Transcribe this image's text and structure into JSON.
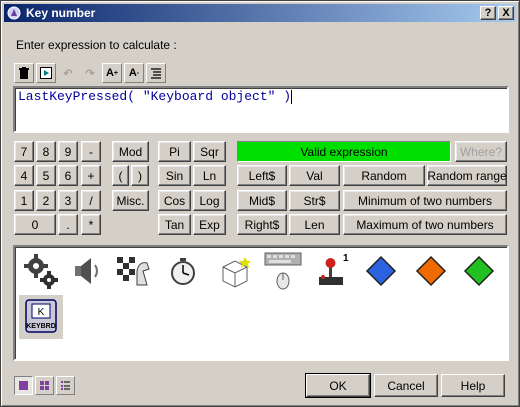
{
  "window": {
    "title": "Key number"
  },
  "titlebar_buttons": {
    "help": "?",
    "close": "X"
  },
  "prompt_label": "Enter expression to calculate :",
  "toolbar": {
    "items": [
      {
        "icon": "trash-icon",
        "glyph": "🗑"
      },
      {
        "icon": "insert-icon",
        "glyph": "▣"
      },
      {
        "icon": "undo-icon",
        "glyph": "↶"
      },
      {
        "icon": "redo-icon",
        "glyph": "↷"
      },
      {
        "icon": "font-larger-icon",
        "glyph": "A⁺"
      },
      {
        "icon": "font-smaller-icon",
        "glyph": "A⁻"
      },
      {
        "icon": "format-icon",
        "glyph": "⇶"
      }
    ]
  },
  "expression": "LastKeyPressed( \"Keyboard object\" )",
  "keypad": {
    "row1": [
      "7",
      "8",
      "9",
      "-"
    ],
    "row2": [
      "4",
      "5",
      "6",
      "+"
    ],
    "row3": [
      "1",
      "2",
      "3",
      "/"
    ],
    "row4": [
      "0",
      ".",
      "*"
    ]
  },
  "mod_label": "Mod",
  "paren_open": "(",
  "paren_close": ")",
  "misc_label": "Misc.",
  "functions": {
    "pi": "Pi",
    "sqr": "Sqr",
    "sin": "Sin",
    "ln": "Ln",
    "cos": "Cos",
    "log": "Log",
    "tan": "Tan",
    "exp": "Exp",
    "left": "Left$",
    "val": "Val",
    "mid": "Mid$",
    "str": "Str$",
    "right": "Right$",
    "len": "Len"
  },
  "status": "Valid expression",
  "where_label": "Where?",
  "random_label": "Random",
  "random_range_label": "Random range",
  "min_label": "Minimum of two numbers",
  "max_label": "Maximum of two numbers",
  "objects": [
    {
      "name": "special-conditions-icon"
    },
    {
      "name": "sound-icon"
    },
    {
      "name": "storyboard-icon"
    },
    {
      "name": "timer-icon"
    },
    {
      "name": "create-object-icon"
    },
    {
      "name": "mouse-keyboard-icon"
    },
    {
      "name": "player-joystick-icon",
      "badge": "1"
    },
    {
      "name": "blue-diamond-icon",
      "color": "#2a62e0"
    },
    {
      "name": "orange-diamond-icon",
      "color": "#f06a00"
    },
    {
      "name": "green-diamond-icon",
      "color": "#20c020"
    },
    {
      "name": "keyboard-object-icon",
      "caption": "KEYBRD",
      "key": "K"
    }
  ],
  "dialog": {
    "ok": "OK",
    "cancel": "Cancel",
    "help": "Help"
  }
}
